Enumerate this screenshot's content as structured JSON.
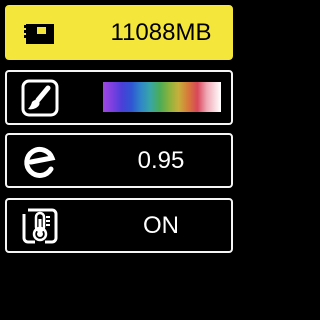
{
  "storage": {
    "value": "11088MB",
    "icon": "sd-card-icon"
  },
  "palette": {
    "icon": "paint-brush-icon"
  },
  "emissivity": {
    "value": "0.95",
    "icon": "emissivity-icon"
  },
  "temperature": {
    "value": "ON",
    "icon": "thermometer-icon"
  },
  "colors": {
    "selected_bg": "#f5e63c",
    "border": "#f5f5f5",
    "background": "#000000"
  }
}
